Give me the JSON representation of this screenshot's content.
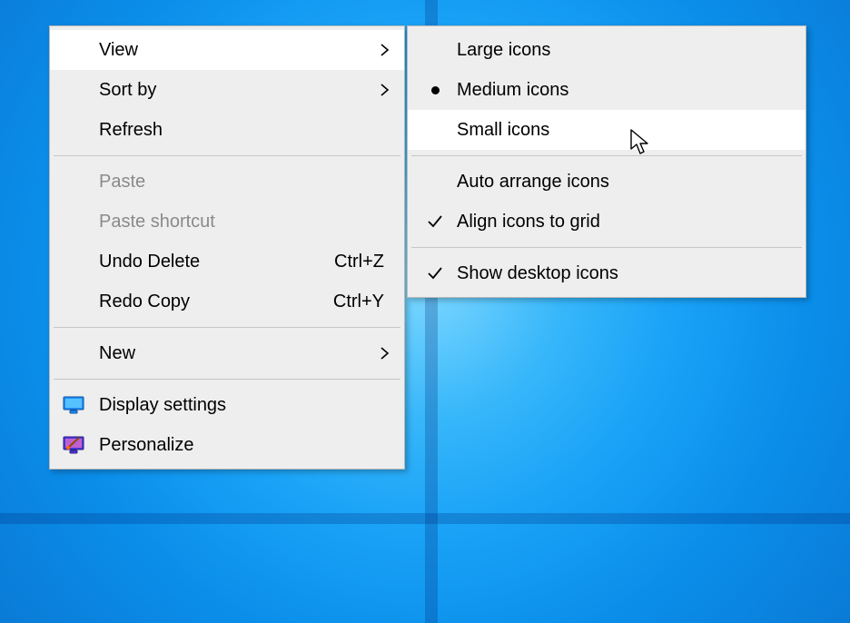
{
  "context_menu": {
    "items": {
      "view": {
        "label": "View"
      },
      "sort_by": {
        "label": "Sort by"
      },
      "refresh": {
        "label": "Refresh"
      },
      "paste": {
        "label": "Paste"
      },
      "paste_shortcut": {
        "label": "Paste shortcut"
      },
      "undo_delete": {
        "label": "Undo Delete",
        "shortcut": "Ctrl+Z"
      },
      "redo_copy": {
        "label": "Redo Copy",
        "shortcut": "Ctrl+Y"
      },
      "new": {
        "label": "New"
      },
      "display": {
        "label": "Display settings"
      },
      "personalize": {
        "label": "Personalize"
      }
    }
  },
  "view_submenu": {
    "large": {
      "label": "Large icons"
    },
    "medium": {
      "label": "Medium icons"
    },
    "small": {
      "label": "Small icons"
    },
    "auto": {
      "label": "Auto arrange icons"
    },
    "align": {
      "label": "Align icons to grid"
    },
    "show": {
      "label": "Show desktop icons"
    },
    "selected": "medium",
    "hovered": "small",
    "checked": [
      "align",
      "show"
    ]
  }
}
